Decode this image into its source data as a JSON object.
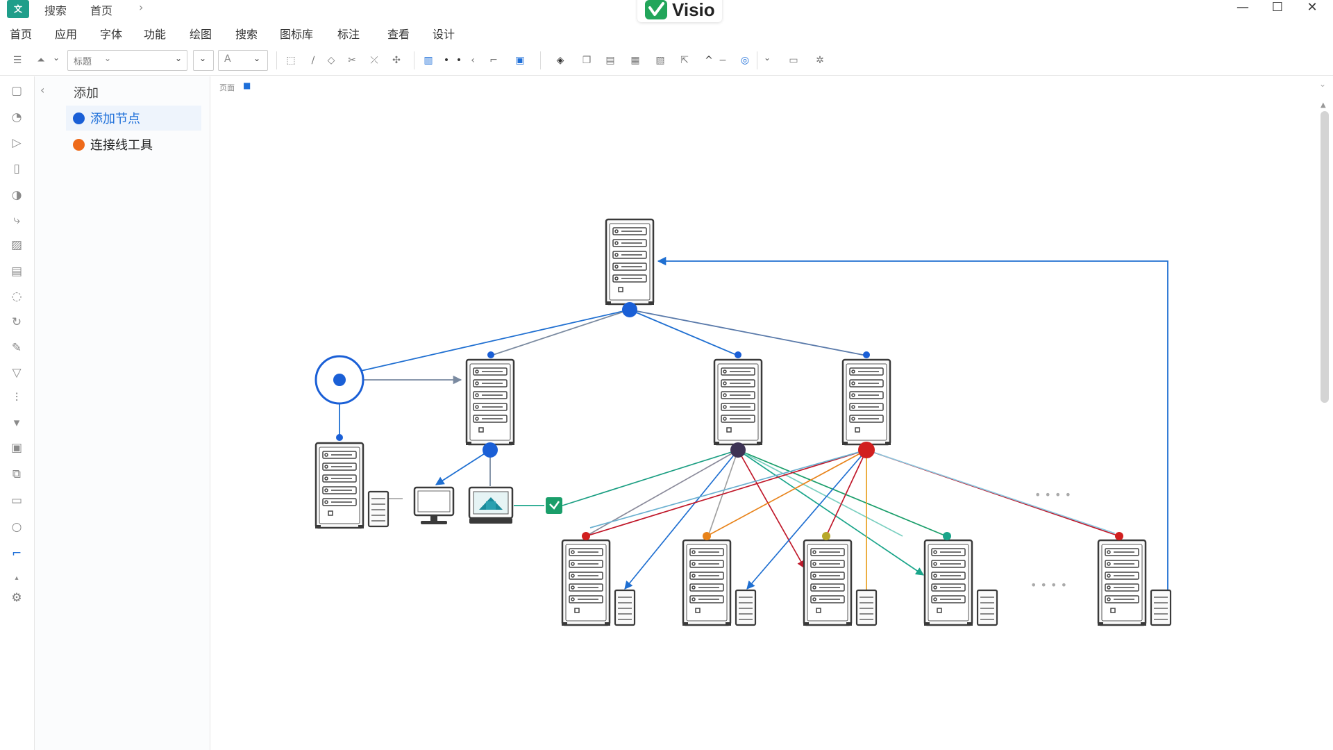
{
  "titlebar": {
    "app_icon": "文",
    "tabs": [
      "搜索",
      "首页"
    ],
    "brand": "Visio",
    "brand_color": "#22a55a"
  },
  "menu": [
    "首页",
    "应用",
    "字体",
    "功能",
    "绘图",
    "搜索",
    "图标库",
    "标注",
    "查看",
    "设计"
  ],
  "toolbar": {
    "dropdown_value": "标题",
    "icons": [
      "list-icon",
      "align-icon",
      "style-dropdown",
      "font-icon",
      "shape-icon",
      "connector-icon",
      "color-icon",
      "arrange-icon",
      "group-icon",
      "layout-icon"
    ]
  },
  "side_panel": {
    "title": "添加",
    "items": [
      {
        "label": "添加节点",
        "color": "#1a5fd6"
      },
      {
        "label": "连接线工具",
        "color": "#ee6a1a"
      }
    ]
  },
  "canvas": {
    "tool_labels": [
      "页面",
      "■"
    ],
    "ellipsis": [
      "• • • •",
      "• • • •"
    ]
  },
  "colors": {
    "blue": "#1f6fd1",
    "navy": "#3d3355",
    "red": "#d11f1f",
    "orange": "#e8831a",
    "teal": "#1a9e82",
    "green": "#1a9e6a",
    "olive": "#b8a82a"
  }
}
